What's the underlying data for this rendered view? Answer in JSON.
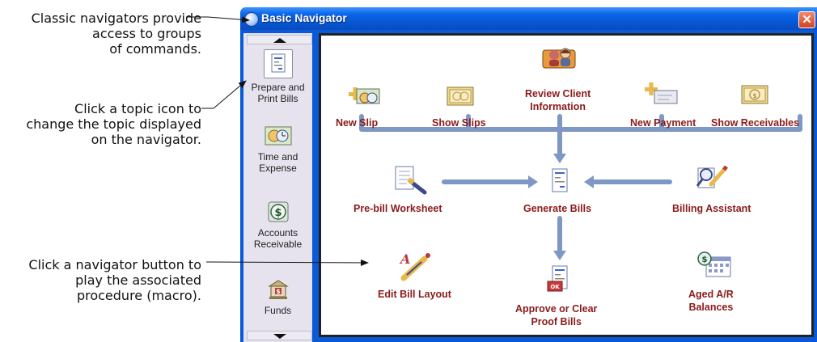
{
  "callouts": {
    "c1_l1": "Classic navigators provide",
    "c1_l2": "access to groups",
    "c1_l3": "of commands.",
    "c2_l1": "Click a topic icon to",
    "c2_l2": "change the topic displayed",
    "c2_l3": "on the navigator.",
    "c3_l1": "Click a navigator button to",
    "c3_l2": "play the associated",
    "c3_l3": "procedure (macro)."
  },
  "window": {
    "title": "Basic Navigator",
    "close_glyph": "✕"
  },
  "sidebar": {
    "topics": [
      {
        "line1": "Prepare and",
        "line2": "Print Bills",
        "icon": "bill-page-icon"
      },
      {
        "line1": "Time and",
        "line2": "Expense",
        "icon": "clock-money-icon"
      },
      {
        "line1": "Accounts",
        "line2": "Receivable",
        "icon": "dollar-coin-icon"
      },
      {
        "line1": "Funds",
        "line2": "",
        "icon": "bank-icon"
      }
    ]
  },
  "navigator": {
    "new_slip": "New Slip",
    "show_slips": "Show Slips",
    "review_client_1": "Review Client",
    "review_client_2": "Information",
    "new_payment": "New Payment",
    "show_receivables": "Show Receivables",
    "prebill": "Pre-bill Worksheet",
    "generate_bills": "Generate Bills",
    "billing_assistant": "Billing Assistant",
    "edit_bill_layout": "Edit Bill Layout",
    "approve_1": "Approve or Clear",
    "approve_2": "Proof Bills",
    "aged_1": "Aged A/R",
    "aged_2": "Balances"
  },
  "colors": {
    "label": "#8B1A1A",
    "flow": "#8EA3C8",
    "title_bar": "#0A5AD8"
  }
}
